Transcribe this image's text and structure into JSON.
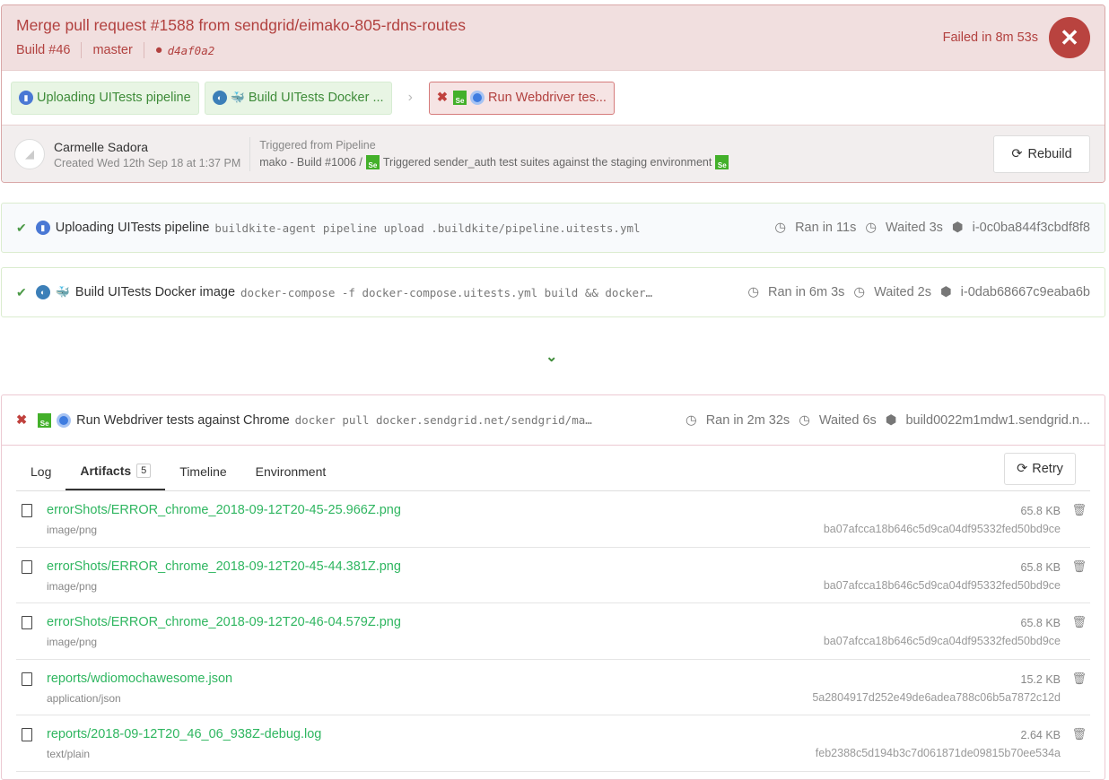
{
  "build": {
    "title": "Merge pull request #1588 from sendgrid/eimako-805-rdns-routes",
    "number": "Build #46",
    "branch": "master",
    "commit": "d4af0a2",
    "status": "Failed in 8m 53s"
  },
  "pipeline_chips": [
    {
      "label": "Uploading UITests pipeline"
    },
    {
      "label": "Build UITests Docker ..."
    },
    {
      "label": "Run Webdriver tes..."
    }
  ],
  "meta": {
    "author": "Carmelle Sadora",
    "created": "Created Wed 12th Sep 18 at 1:37 PM",
    "trigger_label": "Triggered from Pipeline",
    "trigger_source": "mako - Build #1006 /",
    "trigger_desc": "Triggered sender_auth test suites against the staging environment",
    "rebuild": "Rebuild"
  },
  "jobs": [
    {
      "name": "Uploading UITests pipeline",
      "command": "buildkite-agent pipeline upload .buildkite/pipeline.uitests.yml",
      "ran": "Ran in 11s",
      "waited": "Waited 3s",
      "agent": "i-0c0ba844f3cbdf8f8"
    },
    {
      "name": "Build UITests Docker image",
      "command": "docker-compose -f docker-compose.uitests.yml build && docker…",
      "ran": "Ran in 6m 3s",
      "waited": "Waited 2s",
      "agent": "i-0dab68667c9eaba6b"
    },
    {
      "name": "Run Webdriver tests against Chrome",
      "command": "docker pull docker.sendgrid.net/sendgrid/ma…",
      "ran": "Ran in 2m 32s",
      "waited": "Waited 6s",
      "agent": "build0022m1mdw1.sendgrid.n..."
    }
  ],
  "tabs": {
    "log": "Log",
    "artifacts": "Artifacts",
    "artifacts_count": "5",
    "timeline": "Timeline",
    "environment": "Environment",
    "retry": "Retry"
  },
  "artifacts": [
    {
      "name": "errorShots/ERROR_chrome_2018-09-12T20-45-25.966Z.png",
      "type": "image/png",
      "size": "65.8 KB",
      "hash": "ba07afcca18b646c5d9ca04df95332fed50bd9ce"
    },
    {
      "name": "errorShots/ERROR_chrome_2018-09-12T20-45-44.381Z.png",
      "type": "image/png",
      "size": "65.8 KB",
      "hash": "ba07afcca18b646c5d9ca04df95332fed50bd9ce"
    },
    {
      "name": "errorShots/ERROR_chrome_2018-09-12T20-46-04.579Z.png",
      "type": "image/png",
      "size": "65.8 KB",
      "hash": "ba07afcca18b646c5d9ca04df95332fed50bd9ce"
    },
    {
      "name": "reports/wdiomochawesome.json",
      "type": "application/json",
      "size": "15.2 KB",
      "hash": "5a2804917d252e49de6adea788c06b5a7872c12d"
    },
    {
      "name": "reports/2018-09-12T20_46_06_938Z-debug.log",
      "type": "text/plain",
      "size": "2.64 KB",
      "hash": "feb2388c5d194b3c7d061871de09815b70ee534a"
    }
  ]
}
